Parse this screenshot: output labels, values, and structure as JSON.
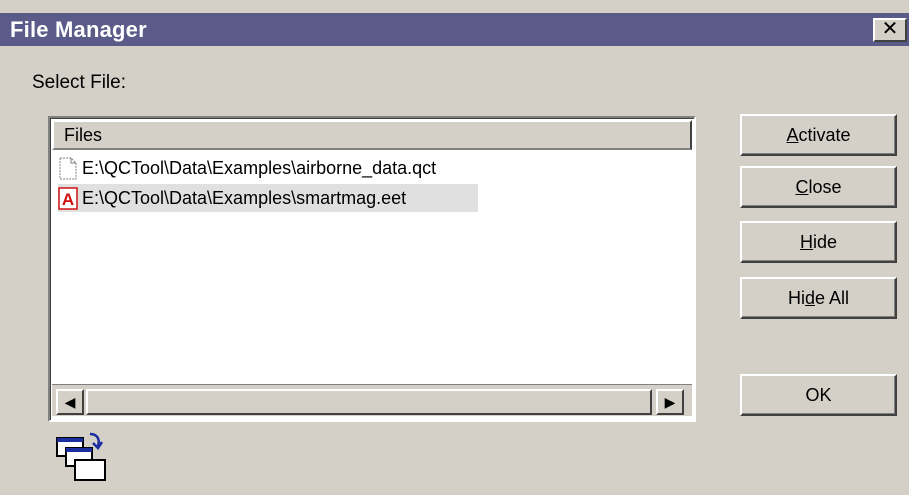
{
  "window": {
    "title": "File Manager",
    "close_glyph": "✕",
    "close_icon": "close-icon"
  },
  "select_label": "Select File:",
  "listbox": {
    "column_header": "Files",
    "rows": [
      {
        "path": "E:\\QCTool\\Data\\Examples\\airborne_data.qct",
        "icon": "document-icon",
        "selected": false
      },
      {
        "path": "E:\\QCTool\\Data\\Examples\\smartmag.eet",
        "icon": "adobe-file-icon",
        "selected": true
      }
    ],
    "scroll_left_glyph": "◀",
    "scroll_right_glyph": "▶"
  },
  "buttons": {
    "activate": {
      "mnemonic": "A",
      "rest": "ctivate"
    },
    "close": {
      "mnemonic": "C",
      "rest": "lose"
    },
    "hide": {
      "mnemonic": "H",
      "rest": "ide"
    },
    "hide_all": {
      "pre": "Hi",
      "mnemonic": "d",
      "rest": "e All"
    },
    "ok": {
      "label": "OK"
    }
  },
  "footer": {
    "icon": "cascade-windows-icon"
  },
  "colors": {
    "titlebar": "#5b5b8a",
    "dialog_bg": "#d4d0c8",
    "selection": "#e0e0e0",
    "acrobat_red": "#d01010",
    "cascade_arrow": "#1a2ea0"
  }
}
